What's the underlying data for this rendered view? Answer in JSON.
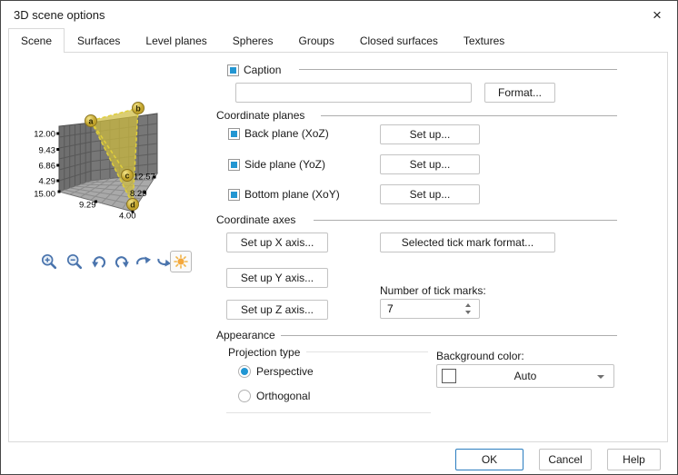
{
  "window": {
    "title": "3D scene options",
    "close_glyph": "×"
  },
  "tabs": [
    {
      "label": "Scene",
      "active": true
    },
    {
      "label": "Surfaces",
      "active": false
    },
    {
      "label": "Level planes",
      "active": false
    },
    {
      "label": "Spheres",
      "active": false
    },
    {
      "label": "Groups",
      "active": false
    },
    {
      "label": "Closed surfaces",
      "active": false
    },
    {
      "label": "Textures",
      "active": false
    }
  ],
  "preview": {
    "vertices": [
      "a",
      "b",
      "c",
      "d"
    ],
    "z_axis_ticks": [
      "12.00",
      "9.43",
      "6.86",
      "4.29"
    ],
    "front_left_ticks": [
      "15.00",
      "9.29",
      "4.00"
    ],
    "front_right_ticks": [
      "12.57",
      "8.29"
    ],
    "toolbar": [
      {
        "name": "zoom-in"
      },
      {
        "name": "zoom-out"
      },
      {
        "name": "rotate-left"
      },
      {
        "name": "rotate-right"
      },
      {
        "name": "rotate-forward"
      },
      {
        "name": "rotate-back"
      },
      {
        "name": "light",
        "active": true
      }
    ],
    "colors": {
      "wall": "#6f6f6f",
      "floor": "#a9a9a9",
      "shape_yellow": "#cdbb3e"
    }
  },
  "caption": {
    "checked": true,
    "label": "Caption",
    "value": "",
    "format_button": "Format..."
  },
  "coordinate_planes": {
    "title": "Coordinate planes",
    "rows": [
      {
        "checked": true,
        "label": "Back plane (XoZ)",
        "button": "Set up..."
      },
      {
        "checked": true,
        "label": "Side plane (YoZ)",
        "button": "Set up..."
      },
      {
        "checked": true,
        "label": "Bottom plane (XoY)",
        "button": "Set up..."
      }
    ]
  },
  "coordinate_axes": {
    "title": "Coordinate axes",
    "x_axis_button": "Set up X axis...",
    "y_axis_button": "Set up Y axis...",
    "z_axis_button": "Set up Z axis...",
    "tick_format_button": "Selected tick mark format...",
    "tick_count_label": "Number of tick marks:",
    "tick_count_value": "7"
  },
  "appearance": {
    "title": "Appearance",
    "projection": {
      "label": "Projection type",
      "options": [
        {
          "label": "Perspective",
          "selected": true
        },
        {
          "label": "Orthogonal",
          "selected": false
        }
      ]
    },
    "background_color": {
      "label": "Background color:",
      "value": "Auto",
      "swatch": "#ffffff"
    }
  },
  "footer": {
    "ok": "OK",
    "cancel": "Cancel",
    "help": "Help"
  },
  "colors": {
    "accent_blue": "#2396d2",
    "default_button_border": "#2a7dc0",
    "icon_blue": "#4a74ad",
    "sun_orange": "#f5a83c"
  }
}
